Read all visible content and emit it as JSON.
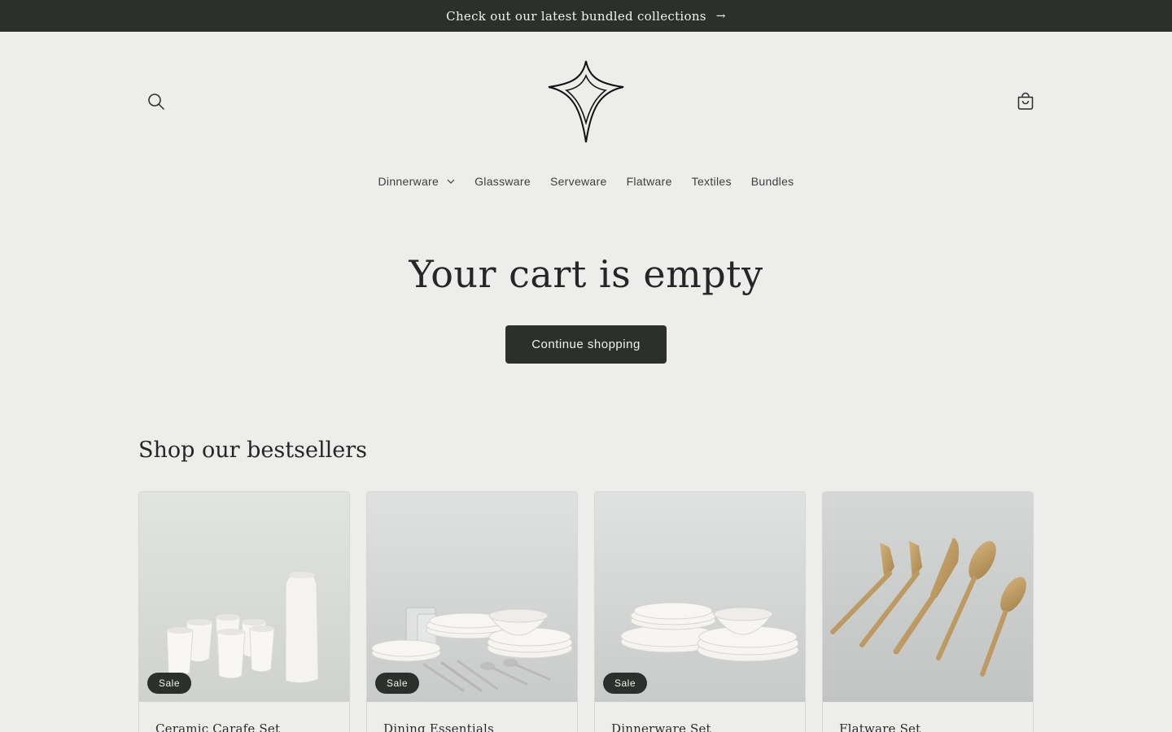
{
  "announcement": {
    "text": "Check out our latest bundled collections",
    "arrow": "→"
  },
  "header": {
    "search_icon": "search-icon",
    "logo": "four-point-star-logo",
    "cart_icon": "cart-icon"
  },
  "nav": {
    "items": [
      {
        "label": "Dinnerware",
        "has_dropdown": true
      },
      {
        "label": "Glassware"
      },
      {
        "label": "Serveware"
      },
      {
        "label": "Flatware"
      },
      {
        "label": "Textiles"
      },
      {
        "label": "Bundles"
      }
    ]
  },
  "cart": {
    "title": "Your cart is empty",
    "continue_label": "Continue shopping"
  },
  "bestsellers": {
    "title": "Shop our bestsellers",
    "products": [
      {
        "name": "Ceramic Carafe Set",
        "badge": "Sale"
      },
      {
        "name": "Dining Essentials",
        "badge": "Sale"
      },
      {
        "name": "Dinnerware Set",
        "badge": "Sale"
      },
      {
        "name": "Flatware Set",
        "badge": ""
      }
    ]
  },
  "colors": {
    "background": "#ededeb",
    "dark": "#2b302d",
    "text": "#262626"
  }
}
